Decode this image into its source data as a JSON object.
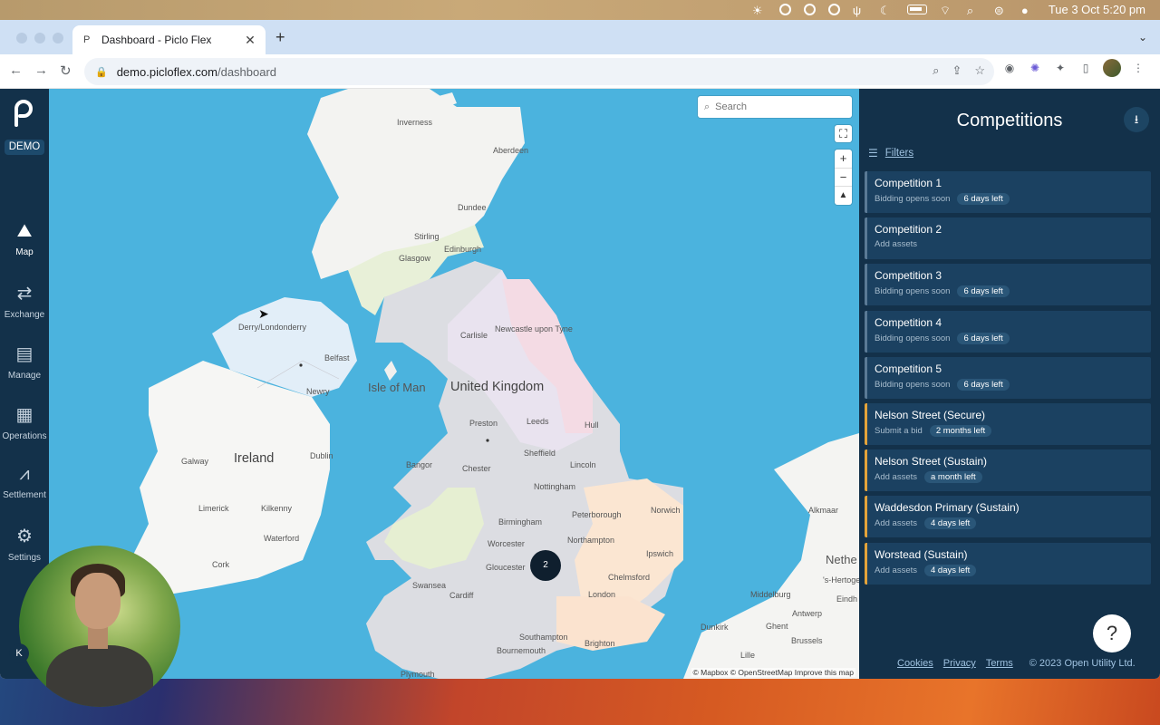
{
  "menubar": {
    "clock": "Tue 3 Oct  5:20 pm"
  },
  "browser": {
    "tab_title": "Dashboard - Piclo Flex",
    "url_host": "demo.picloflex.com",
    "url_path": "/dashboard",
    "new_tab": "+"
  },
  "sidebar": {
    "badge": "DEMO",
    "items": [
      {
        "label": "Map",
        "icon": "map-icon"
      },
      {
        "label": "Exchange",
        "icon": "exchange-icon"
      },
      {
        "label": "Manage",
        "icon": "document-icon"
      },
      {
        "label": "Operations",
        "icon": "calendar-icon"
      },
      {
        "label": "Settlement",
        "icon": "chart-icon"
      },
      {
        "label": "Settings",
        "icon": "gear-icon"
      }
    ],
    "user_initial": "K"
  },
  "map": {
    "search_placeholder": "Search",
    "cluster_count": "2",
    "attribution": {
      "mapbox": "© Mapbox",
      "osm": "© OpenStreetMap",
      "improve": "Improve this map"
    },
    "labels": {
      "inverness": "Inverness",
      "aberdeen": "Aberdeen",
      "dundee": "Dundee",
      "stirling": "Stirling",
      "edinburgh": "Edinburgh",
      "glasgow": "Glasgow",
      "derry": "Derry/Londonderry",
      "belfast": "Belfast",
      "newry": "Newry",
      "isle_of_man": "Isle of Man",
      "uk": "United Kingdom",
      "newcastle": "Newcastle upon Tyne",
      "carlisle": "Carlisle",
      "preston": "Preston",
      "leeds": "Leeds",
      "hull": "Hull",
      "ireland": "Ireland",
      "dublin": "Dublin",
      "galway": "Galway",
      "sheffield": "Sheffield",
      "bangor": "Bangor",
      "chester": "Chester",
      "lincoln": "Lincoln",
      "nottingham": "Nottingham",
      "limerick": "Limerick",
      "kilkenny": "Kilkenny",
      "peterborough": "Peterborough",
      "norwich": "Norwich",
      "birmingham": "Birmingham",
      "waterford": "Waterford",
      "northampton": "Northampton",
      "worcester": "Worcester",
      "ipswich": "Ipswich",
      "cork": "Cork",
      "gloucester": "Gloucester",
      "chelmsford": "Chelmsford",
      "swansea": "Swansea",
      "cardiff": "Cardiff",
      "london": "London",
      "alkmaar": "Alkmaar",
      "netherlands": "Nethe",
      "hertogen": "'s-Hertoge",
      "middelburg": "Middelburg",
      "eindh": "Eindh",
      "antwerp": "Antwerp",
      "dunkirk": "Dunkirk",
      "ghent": "Ghent",
      "brussels": "Brussels",
      "lille": "Lille",
      "southampton": "Southampton",
      "brighton": "Brighton",
      "bournemouth": "Bournemouth",
      "plymouth": "Plymouth"
    }
  },
  "panel": {
    "title": "Competitions",
    "filters_label": "Filters",
    "competitions": [
      {
        "name": "Competition 1",
        "status": "Bidding opens soon",
        "time": "6 days left",
        "accent": "#5a7a95"
      },
      {
        "name": "Competition 2",
        "status": "Add assets",
        "time": "",
        "accent": "#5a7a95"
      },
      {
        "name": "Competition 3",
        "status": "Bidding opens soon",
        "time": "6 days left",
        "accent": "#5a7a95"
      },
      {
        "name": "Competition 4",
        "status": "Bidding opens soon",
        "time": "6 days left",
        "accent": "#5a7a95"
      },
      {
        "name": "Competition 5",
        "status": "Bidding opens soon",
        "time": "6 days left",
        "accent": "#5a7a95"
      },
      {
        "name": "Nelson Street (Secure)",
        "status": "Submit a bid",
        "time": "2 months left",
        "accent": "#e3a33a"
      },
      {
        "name": "Nelson Street (Sustain)",
        "status": "Add assets",
        "time": "a month left",
        "accent": "#e3a33a"
      },
      {
        "name": "Waddesdon Primary (Sustain)",
        "status": "Add assets",
        "time": "4 days left",
        "accent": "#e3a33a"
      },
      {
        "name": "Worstead (Sustain)",
        "status": "Add assets",
        "time": "4 days left",
        "accent": "#e3a33a"
      }
    ],
    "footer": {
      "cookies": "Cookies",
      "privacy": "Privacy",
      "terms": "Terms",
      "copyright": "© 2023 Open Utility Ltd."
    },
    "help": "?"
  }
}
